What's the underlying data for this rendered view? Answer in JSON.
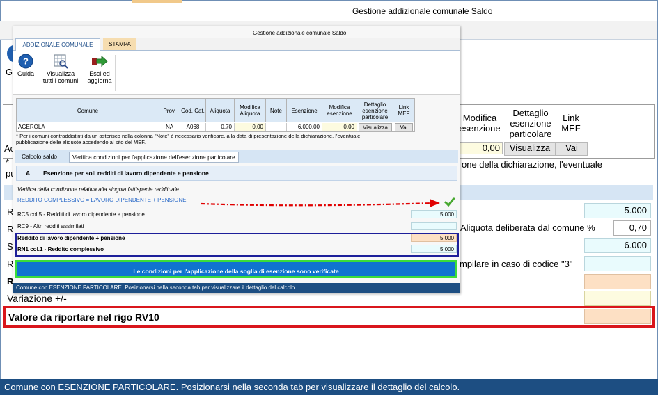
{
  "background_window": {
    "title": "Gestione addizionale comunale Saldo",
    "ribbon_fragment": "Gi",
    "columns": [
      "Modifica esenzione",
      "Dettaglio esenzione particolare",
      "Link MEF"
    ],
    "row": {
      "modifica_esenzione": "0,00",
      "dettaglio": "Visualizza",
      "link": "Vai"
    },
    "note_fragment": "one della dichiarazione, l'eventuale",
    "left_fragments": [
      "Ac",
      "*",
      "pu",
      "R",
      "R",
      "S",
      "R",
      "R"
    ],
    "fields": {
      "v1": "5.000",
      "aliquota_label": "Aliquota deliberata dal comune %",
      "aliquota_value": "0,70",
      "v3": "6.000",
      "codice3_label": "mpilare in caso di codice \"3\"",
      "variazione_label": "Variazione +/-",
      "valore_label": "Valore da riportare nel rigo RV10"
    },
    "status": "Comune con ESENZIONE PARTICOLARE. Posizionarsi nella seconda tab per visualizzare il dettaglio del calcolo."
  },
  "dialog": {
    "title": "Gestione addizionale comunale Saldo",
    "tabs": [
      "ADDIZIONALE COMUNALE",
      "STAMPA"
    ],
    "ribbon": {
      "guida": "Guida",
      "visualizza_1": "Visualizza",
      "visualizza_2": "tutti i comuni",
      "esci_1": "Esci ed",
      "esci_2": "aggiorna"
    },
    "grid": {
      "headers": [
        "Comune",
        "Prov.",
        "Cod. Cat.",
        "Aliquota",
        "Modifica Aliquota",
        "Note",
        "Esenzione",
        "Modifica esenzione",
        "Dettaglio esenzione particolare",
        "Link MEF"
      ],
      "row": [
        "AGEROLA",
        "NA",
        "A068",
        "0,70",
        "0,00",
        "",
        "6.000,00",
        "0,00",
        "Visualizza",
        "Vai"
      ]
    },
    "note_1": "* Per i comuni contraddistinti da un asterisco nella colonna \"Note\" è necessario verificare,  alla data di presentazione della dichiarazione, l'eventuale",
    "note_2": "pubblicazione delle aliquote accedendo al sito del MEF.",
    "subtabs": [
      "Calcolo saldo",
      "Verifica condizioni per l'applicazione dell'esenzione particolare"
    ],
    "section": {
      "letter": "A",
      "title": "Esenzione per soli redditi di lavoro dipendente e pensione"
    },
    "verifica": "Verifica della condizione relativa alla singola fattispecie reddituale",
    "formula": "REDDITO COMPLESSIVO = LAVORO DIPENDENTE + PENSIONE",
    "rows": [
      {
        "label": "RC5 col.5 - Redditi di lavoro dipendente e pensione",
        "value": "5.000"
      },
      {
        "label": "RC9 - Altri redditi assimilati",
        "value": ""
      },
      {
        "label": "Reddito di lavoro dipendente + pensione",
        "value": "5.000"
      },
      {
        "label": "RN1 col.1 - Reddito complessivo",
        "value": "5.000"
      }
    ],
    "result": "Le condizioni per l'applicazione della soglia di esenzione sono verificate",
    "status": "Comune con ESENZIONE PARTICOLARE. Posizionarsi nella seconda tab per visualizzare il dettaglio del calcolo."
  },
  "colors": {
    "status_bar": "#1d4e82",
    "result_bg": "#0f73d0",
    "green_frame": "#3adc3a",
    "blue_frame": "#1d1f9a",
    "red_frame": "#d9161c",
    "red_arrow": "#e00000",
    "check": "#47a82f"
  }
}
